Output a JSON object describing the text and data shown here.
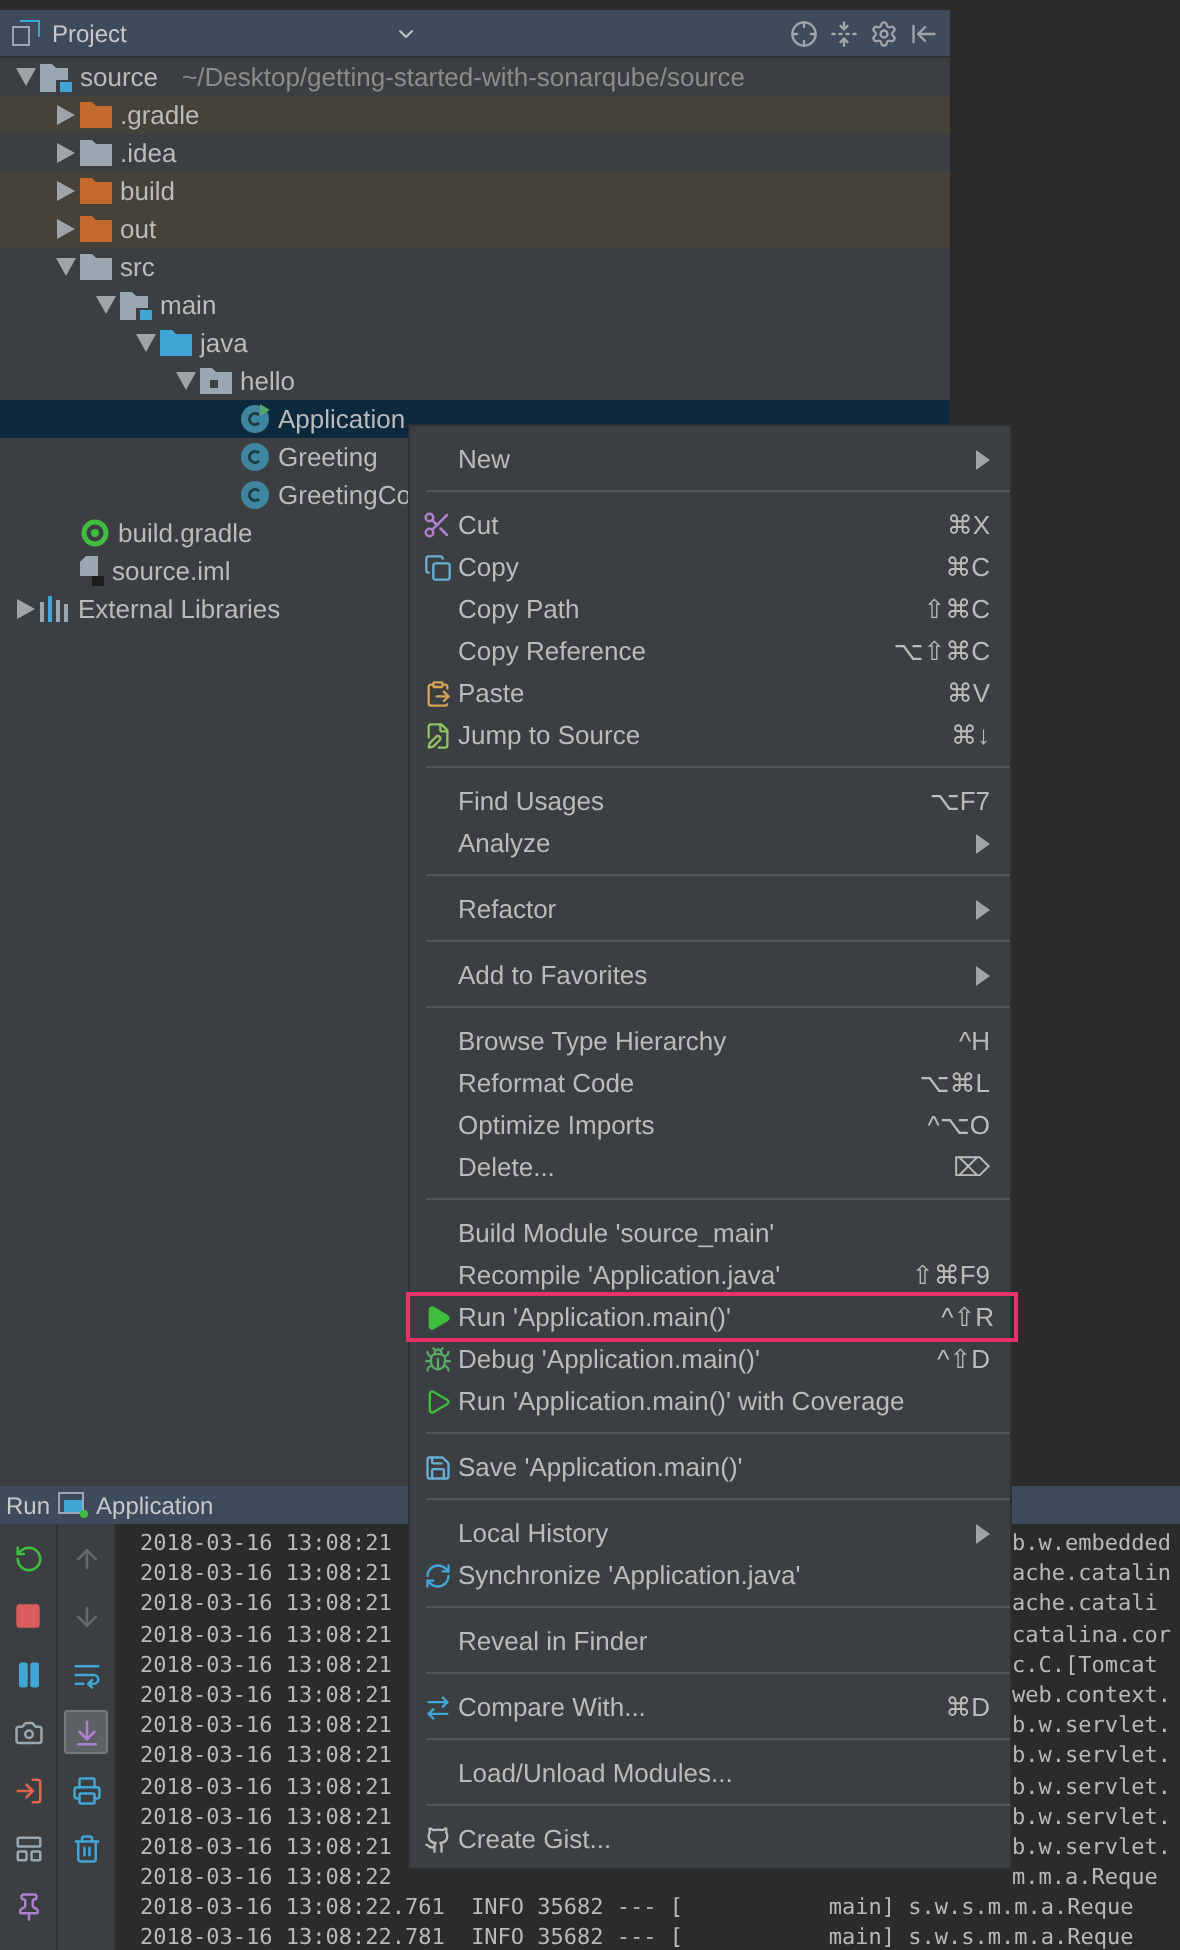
{
  "project_panel": {
    "title": "Project",
    "tree": [
      {
        "label": "source",
        "path": "~/Desktop/getting-started-with-sonarqube/source",
        "kind": "module",
        "expanded": true,
        "selected": false,
        "children": [
          {
            "label": ".gradle",
            "kind": "excluded",
            "expanded": false,
            "selected": false
          },
          {
            "label": ".idea",
            "kind": "folder",
            "expanded": false,
            "selected": false
          },
          {
            "label": "build",
            "kind": "excluded",
            "expanded": false,
            "selected": false
          },
          {
            "label": "out",
            "kind": "excluded",
            "expanded": false,
            "selected": false
          },
          {
            "label": "src",
            "kind": "folder",
            "expanded": true,
            "selected": false,
            "children": [
              {
                "label": "main",
                "kind": "module",
                "expanded": true,
                "selected": false,
                "children": [
                  {
                    "label": "java",
                    "kind": "source",
                    "expanded": true,
                    "selected": false,
                    "children": [
                      {
                        "label": "hello",
                        "kind": "package",
                        "expanded": true,
                        "selected": false,
                        "children": [
                          {
                            "label": "Application",
                            "kind": "main-class",
                            "selected": true
                          },
                          {
                            "label": "Greeting",
                            "kind": "class",
                            "selected": false
                          },
                          {
                            "label": "GreetingCo",
                            "kind": "class",
                            "selected": false
                          }
                        ]
                      }
                    ]
                  }
                ]
              }
            ]
          },
          {
            "label": "build.gradle",
            "kind": "gradle",
            "selected": false
          },
          {
            "label": "source.iml",
            "kind": "iml",
            "selected": false
          }
        ]
      },
      {
        "label": "External Libraries",
        "kind": "libraries",
        "expanded": false,
        "selected": false
      }
    ]
  },
  "context_menu": [
    [
      {
        "label": "New",
        "submenu": true
      }
    ],
    [
      {
        "label": "Cut",
        "shortcut": "⌘X"
      },
      {
        "label": "Copy",
        "shortcut": "⌘C"
      },
      {
        "label": "Copy Path",
        "shortcut": "⇧⌘C"
      },
      {
        "label": "Copy Reference",
        "shortcut": "⌥⇧⌘C"
      },
      {
        "label": "Paste",
        "shortcut": "⌘V"
      },
      {
        "label": "Jump to Source",
        "shortcut": "⌘↓"
      }
    ],
    [
      {
        "label": "Find Usages",
        "shortcut": "⌥F7"
      },
      {
        "label": "Analyze",
        "submenu": true
      }
    ],
    [
      {
        "label": "Refactor",
        "submenu": true
      }
    ],
    [
      {
        "label": "Add to Favorites",
        "submenu": true
      }
    ],
    [
      {
        "label": "Browse Type Hierarchy",
        "shortcut": "^H"
      },
      {
        "label": "Reformat Code",
        "shortcut": "⌥⌘L"
      },
      {
        "label": "Optimize Imports",
        "shortcut": "^⌥O"
      },
      {
        "label": "Delete...",
        "shortcut": "⌦"
      }
    ],
    [
      {
        "label": "Build Module 'source_main'"
      },
      {
        "label": "Recompile 'Application.java'",
        "shortcut": "⇧⌘F9"
      },
      {
        "label": "Run 'Application.main()'",
        "shortcut": "^⇧R",
        "highlighted": true
      },
      {
        "label": "Debug 'Application.main()'",
        "shortcut": "^⇧D"
      },
      {
        "label": "Run 'Application.main()' with Coverage"
      }
    ],
    [
      {
        "label": "Save 'Application.main()'"
      }
    ],
    [
      {
        "label": "Local History",
        "submenu": true
      },
      {
        "label": "Synchronize 'Application.java'"
      }
    ],
    [
      {
        "label": "Reveal in Finder"
      }
    ],
    [
      {
        "label": "Compare With...",
        "shortcut": "⌘D"
      }
    ],
    [
      {
        "label": "Load/Unload Modules..."
      }
    ],
    [
      {
        "label": "Create Gist..."
      }
    ]
  ],
  "run_panel": {
    "label": "Run",
    "config": "Application",
    "console_tools": [
      {
        "disabled": true,
        "pressed": false
      },
      {
        "disabled": true,
        "pressed": false
      },
      {
        "disabled": false,
        "pressed": false
      },
      {
        "disabled": false,
        "pressed": true
      },
      {
        "disabled": false,
        "pressed": false
      },
      {
        "disabled": false,
        "pressed": false
      }
    ],
    "log": [
      {
        "left": "2018-03-16 13:08:21",
        "right": "b.w.embedded"
      },
      {
        "left": "2018-03-16 13:08:21",
        "right": "ache.catalin"
      },
      {
        "left": "2018-03-16 13:08:21",
        "right": "ache.catali"
      },
      {
        "left": "2018-03-16 13:08:21",
        "right": "catalina.cor"
      },
      {
        "left": "2018-03-16 13:08:21",
        "right": "c.C.[Tomcat"
      },
      {
        "left": "2018-03-16 13:08:21",
        "right": "web.context."
      },
      {
        "left": "2018-03-16 13:08:21",
        "right": "b.w.servlet."
      },
      {
        "left": "2018-03-16 13:08:21",
        "right": "b.w.servlet."
      },
      {
        "left": "2018-03-16 13:08:21",
        "right": "b.w.servlet."
      },
      {
        "left": "2018-03-16 13:08:21",
        "right": "b.w.servlet."
      },
      {
        "left": "2018-03-16 13:08:21",
        "right": "b.w.servlet."
      },
      {
        "left": "2018-03-16 13:08:22",
        "right": "m.m.a.Reque"
      },
      {
        "text": "2018-03-16 13:08:22.761  INFO 35682 --- [           main] s.w.s.m.m.a.Reque"
      },
      {
        "text": "2018-03-16 13:08:22.781  INFO 35682 --- [           main] s.w.s.m.m.a.Reque"
      }
    ]
  }
}
